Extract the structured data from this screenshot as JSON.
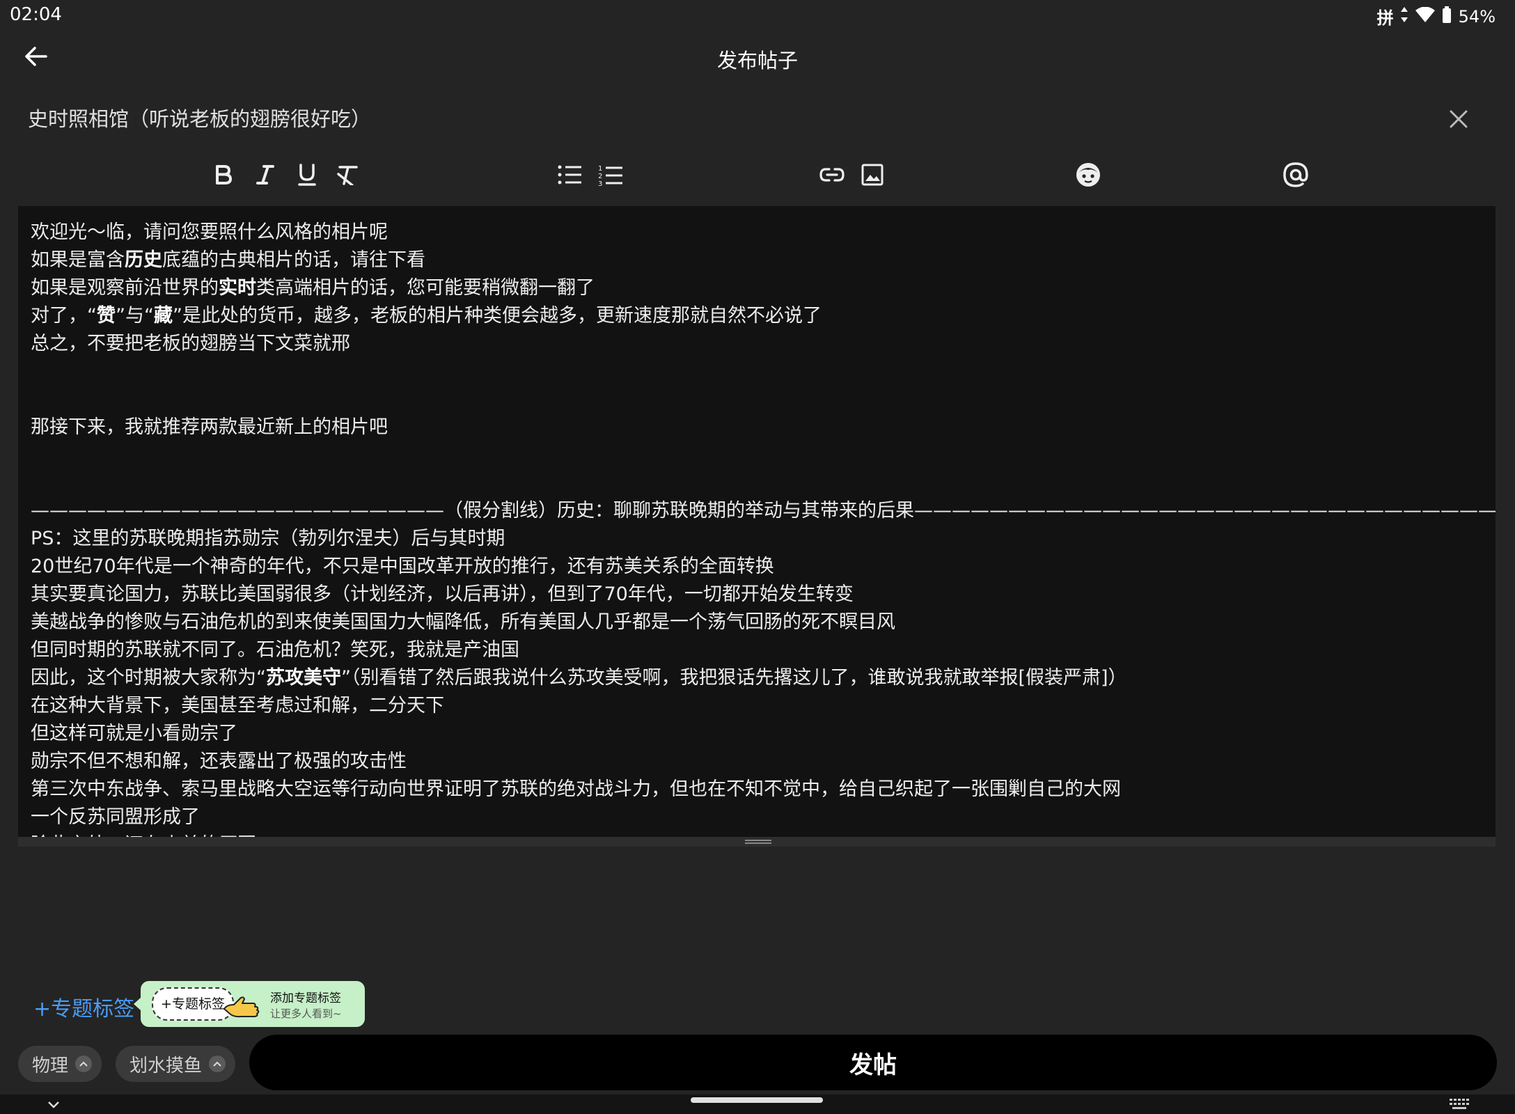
{
  "status": {
    "time": "02:04",
    "ime": "拼",
    "battery": "54%"
  },
  "header": {
    "title": "发布帖子"
  },
  "post": {
    "title": "史时照相馆（听说老板的翅膀很好吃）"
  },
  "editor": {
    "lines": [
      [
        {
          "t": "欢迎光～临，请问您要照什么风格的相片呢"
        }
      ],
      [
        {
          "t": "如果是富含"
        },
        {
          "t": "历史",
          "b": true
        },
        {
          "t": "底蕴的古典相片的话，请往下看"
        }
      ],
      [
        {
          "t": "如果是观察前沿世界的"
        },
        {
          "t": "实时",
          "b": true
        },
        {
          "t": "类高端相片的话，您可能要稍微翻一翻了"
        }
      ],
      [
        {
          "t": "对了，“"
        },
        {
          "t": "赞",
          "b": true
        },
        {
          "t": "”与“"
        },
        {
          "t": "藏",
          "b": true
        },
        {
          "t": "”是此处的货币，越多，老板的相片种类便会越多，更新速度那就自然不必说了"
        }
      ],
      [
        {
          "t": "总之，不要把老板的翅膀当下文菜就邢"
        }
      ],
      [],
      [],
      [
        {
          "t": "那接下来，我就推荐两款最近新上的相片吧"
        }
      ],
      [],
      [],
      [
        {
          "t": "——————————————————————（假分割线）历史：聊聊苏联晚期的举动与其带来的后果——————————————————————————————————"
        }
      ],
      [
        {
          "t": "PS：这里的苏联晚期指苏勋宗（勃列尔涅夫）后与其时期"
        }
      ],
      [
        {
          "t": "20世纪70年代是一个神奇的年代，不只是中国改革开放的推行，还有苏美关系的全面转换"
        }
      ],
      [
        {
          "t": "其实要真论国力，苏联比美国弱很多（计划经济，以后再讲），但到了70年代，一切都开始发生转变"
        }
      ],
      [
        {
          "t": "美越战争的惨败与石油危机的到来使美国国力大幅降低，所有美国人几乎都是一个荡气回肠的死不瞑目风"
        }
      ],
      [
        {
          "t": "但同时期的苏联就不同了。石油危机？笑死，我就是产油国"
        }
      ],
      [
        {
          "t": "因此，这个时期被大家称为“"
        },
        {
          "t": "苏攻美守",
          "b": true
        },
        {
          "t": "”（别看错了然后跟我说什么苏攻美受啊，我把狠话先撂这儿了，谁敢说我就敢举报[假装严肃]）"
        }
      ],
      [
        {
          "t": "在这种大背景下，美国甚至考虑过和解，二分天下"
        }
      ],
      [
        {
          "t": "但这样可就是小看勋宗了"
        }
      ],
      [
        {
          "t": "勋宗不但不想和解，还表露出了极强的攻击性"
        }
      ],
      [
        {
          "t": "第三次中东战争、索马里战略大空运等行动向世界证明了苏联的绝对战斗力，但也在不知不觉中，给自己织起了一张围剿自己的大网"
        }
      ],
      [
        {
          "t": "一个反苏同盟形成了"
        }
      ],
      [
        {
          "t": "除此之外，还有小弟的原因"
        }
      ]
    ]
  },
  "topic": {
    "add_label": "+专题标签",
    "hint_chip": "+专题标签",
    "hint_title": "添加专题标签",
    "hint_sub": "让更多人看到~"
  },
  "tags": [
    {
      "label": "物理"
    },
    {
      "label": "划水摸鱼"
    }
  ],
  "publish": {
    "label": "发帖"
  },
  "icons": [
    "back-arrow-icon",
    "close-icon",
    "bold-icon",
    "italic-icon",
    "underline-icon",
    "clear-format-icon",
    "bullet-list-icon",
    "numbered-list-icon",
    "link-icon",
    "image-icon",
    "emoji-icon",
    "mention-icon",
    "wifi-icon",
    "battery-icon",
    "hand-pointer-icon"
  ]
}
